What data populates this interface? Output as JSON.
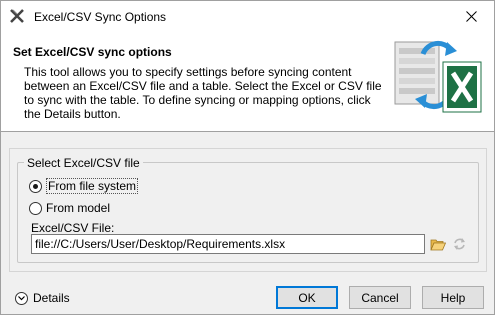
{
  "window": {
    "title": "Excel/CSV Sync Options"
  },
  "banner": {
    "title": "Set Excel/CSV sync options",
    "description": "This tool allows you to specify settings before syncing content between an Excel/CSV file and a table. Select the Excel or CSV file to sync with the table. To define syncing or mapping options, click the Details button.",
    "icon": "excel-sync-icon"
  },
  "file_group": {
    "legend": "Select Excel/CSV file",
    "options": [
      {
        "label": "From file system",
        "checked": true
      },
      {
        "label": "From model",
        "checked": false
      }
    ],
    "file_label": "Excel/CSV File:",
    "file_value": "file://C:/Users/User/Desktop/Requirements.xlsx"
  },
  "footer": {
    "details_label": "Details",
    "ok_label": "OK",
    "cancel_label": "Cancel",
    "help_label": "Help"
  },
  "colors": {
    "accent": "#0078d7",
    "excel_green": "#1e7145"
  }
}
